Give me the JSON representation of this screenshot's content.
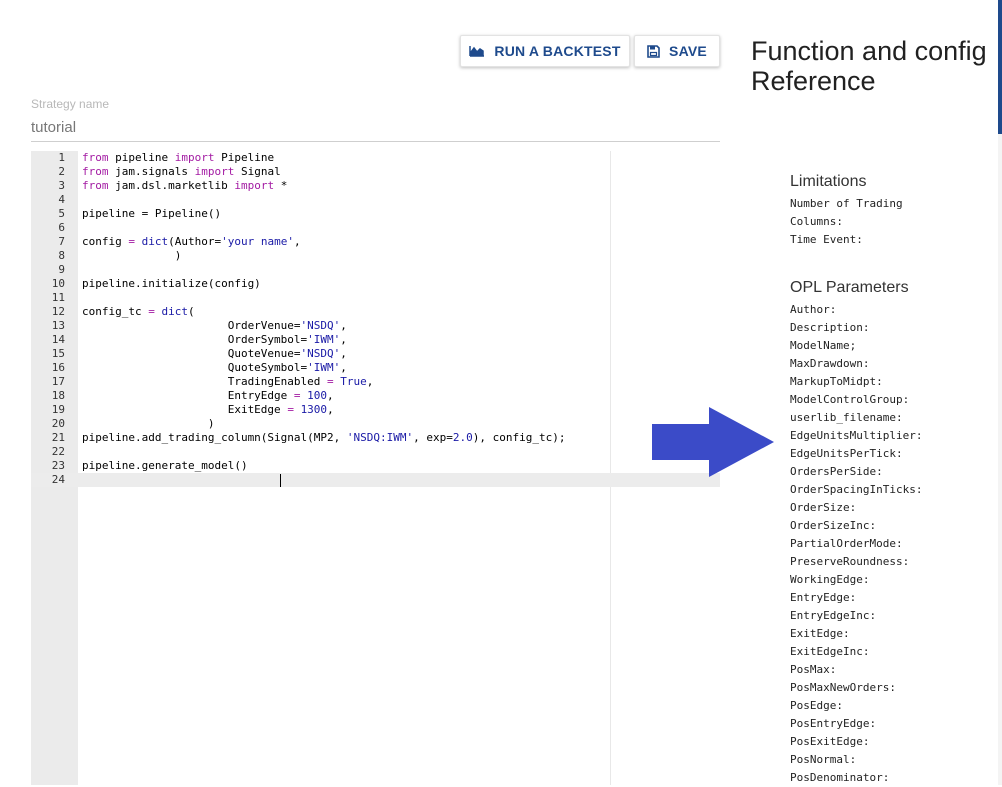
{
  "toolbar": {
    "backtest_label": "RUN A BACKTEST",
    "save_label": "SAVE",
    "accent_color": "#1e4a8c"
  },
  "strategy": {
    "label": "Strategy name",
    "value": "tutorial"
  },
  "editor": {
    "lines": [
      {
        "n": "1",
        "tokens": [
          [
            "k",
            "from"
          ],
          [
            "t",
            " pipeline "
          ],
          [
            "k",
            "import"
          ],
          [
            "t",
            " Pipeline"
          ]
        ]
      },
      {
        "n": "2",
        "tokens": [
          [
            "k",
            "from"
          ],
          [
            "t",
            " jam.signals "
          ],
          [
            "k",
            "import"
          ],
          [
            "t",
            " Signal"
          ]
        ]
      },
      {
        "n": "3",
        "tokens": [
          [
            "k",
            "from"
          ],
          [
            "t",
            " jam.dsl.marketlib "
          ],
          [
            "k",
            "import"
          ],
          [
            "t",
            " *"
          ]
        ]
      },
      {
        "n": "4",
        "tokens": []
      },
      {
        "n": "5",
        "tokens": [
          [
            "t",
            "pipeline = Pipeline()"
          ]
        ]
      },
      {
        "n": "6",
        "tokens": []
      },
      {
        "n": "7",
        "tokens": [
          [
            "t",
            "config "
          ],
          [
            "k",
            "="
          ],
          [
            "t",
            " "
          ],
          [
            "f",
            "dict"
          ],
          [
            "t",
            "(Author="
          ],
          [
            "s",
            "'your name'"
          ],
          [
            "t",
            ","
          ]
        ]
      },
      {
        "n": "8",
        "tokens": [
          [
            "t",
            "              )"
          ]
        ]
      },
      {
        "n": "9",
        "tokens": []
      },
      {
        "n": "10",
        "tokens": [
          [
            "t",
            "pipeline.initialize(config)"
          ]
        ]
      },
      {
        "n": "11",
        "tokens": []
      },
      {
        "n": "12",
        "tokens": [
          [
            "t",
            "config_tc "
          ],
          [
            "k",
            "="
          ],
          [
            "t",
            " "
          ],
          [
            "f",
            "dict"
          ],
          [
            "t",
            "("
          ]
        ]
      },
      {
        "n": "13",
        "tokens": [
          [
            "t",
            "                      OrderVenue="
          ],
          [
            "s",
            "'NSDQ'"
          ],
          [
            "t",
            ","
          ]
        ]
      },
      {
        "n": "14",
        "tokens": [
          [
            "t",
            "                      OrderSymbol="
          ],
          [
            "s",
            "'IWM'"
          ],
          [
            "t",
            ","
          ]
        ]
      },
      {
        "n": "15",
        "tokens": [
          [
            "t",
            "                      QuoteVenue="
          ],
          [
            "s",
            "'NSDQ'"
          ],
          [
            "t",
            ","
          ]
        ]
      },
      {
        "n": "16",
        "tokens": [
          [
            "t",
            "                      QuoteSymbol="
          ],
          [
            "s",
            "'IWM'"
          ],
          [
            "t",
            ","
          ]
        ]
      },
      {
        "n": "17",
        "tokens": [
          [
            "t",
            "                      TradingEnabled "
          ],
          [
            "k",
            "="
          ],
          [
            "t",
            " "
          ],
          [
            "n",
            "True"
          ],
          [
            "t",
            ","
          ]
        ]
      },
      {
        "n": "18",
        "tokens": [
          [
            "t",
            "                      EntryEdge "
          ],
          [
            "k",
            "="
          ],
          [
            "t",
            " "
          ],
          [
            "n",
            "100"
          ],
          [
            "t",
            ","
          ]
        ]
      },
      {
        "n": "19",
        "tokens": [
          [
            "t",
            "                      ExitEdge "
          ],
          [
            "k",
            "="
          ],
          [
            "t",
            " "
          ],
          [
            "n",
            "1300"
          ],
          [
            "t",
            ","
          ]
        ]
      },
      {
        "n": "20",
        "tokens": [
          [
            "t",
            "                   )"
          ]
        ]
      },
      {
        "n": "21",
        "tokens": [
          [
            "t",
            "pipeline.add_trading_column(Signal(MP2, "
          ],
          [
            "s",
            "'NSDQ:IWM'"
          ],
          [
            "t",
            ", exp="
          ],
          [
            "n",
            "2.0"
          ],
          [
            "t",
            "), config_tc);"
          ]
        ]
      },
      {
        "n": "22",
        "tokens": []
      },
      {
        "n": "23",
        "tokens": [
          [
            "t",
            "pipeline.generate_model()"
          ]
        ]
      },
      {
        "n": "24",
        "tokens": [],
        "active": true
      }
    ]
  },
  "reference": {
    "title": "Function and config Reference",
    "limitations": {
      "heading": "Limitations",
      "items": [
        "Number of Trading",
        "Columns:",
        "Time Event:"
      ]
    },
    "opl": {
      "heading": "OPL Parameters",
      "items": [
        "Author:",
        "Description:",
        "ModelName;",
        "MaxDrawdown:",
        "MarkupToMidpt:",
        "ModelControlGroup:",
        "userlib_filename:",
        "EdgeUnitsMultiplier:",
        "EdgeUnitsPerTick:",
        "OrdersPerSide:",
        "OrderSpacingInTicks:",
        "OrderSize:",
        "OrderSizeInc:",
        "PartialOrderMode:",
        "PreserveRoundness:",
        "WorkingEdge:",
        "EntryEdge:",
        "EntryEdgeInc:",
        "ExitEdge:",
        "ExitEdgeInc:",
        "PosMax:",
        "PosMaxNewOrders:",
        "PosEdge:",
        "PosEntryEdge:",
        "PosExitEdge:",
        "PosNormal:",
        "PosDenominator:"
      ]
    }
  },
  "arrow_color": "#3b4bc8"
}
